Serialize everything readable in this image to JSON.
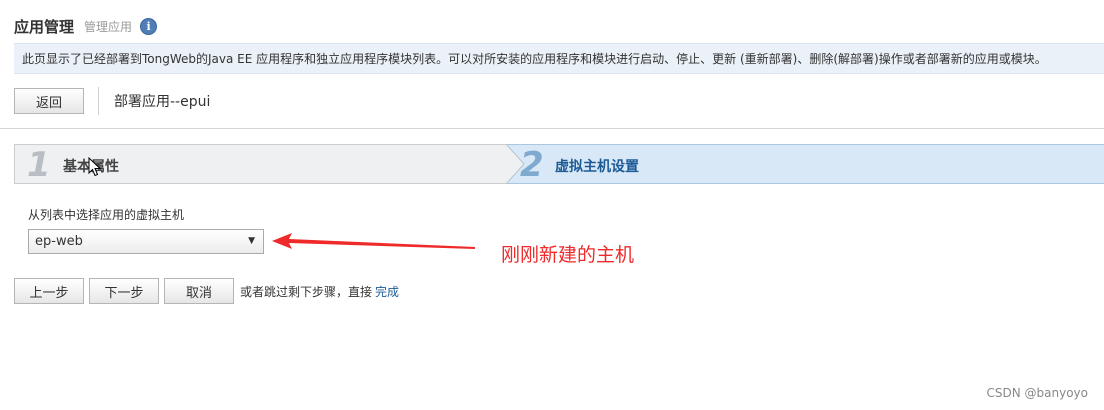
{
  "header": {
    "title": "应用管理",
    "subtitle": "管理应用",
    "info_icon": "info-icon"
  },
  "description": "此页显示了已经部署到TongWeb的Java EE 应用程序和独立应用程序模块列表。可以对所安装的应用程序和模块进行启动、停止、更新 (重新部署)、删除(解部署)操作或者部署新的应用或模块。",
  "toolbar": {
    "back_label": "返回",
    "deploy_title": "部署应用--epui"
  },
  "wizard": {
    "steps": [
      {
        "number": "1",
        "label": "基本属性",
        "active": false
      },
      {
        "number": "2",
        "label": "虚拟主机设置",
        "active": true
      }
    ]
  },
  "form": {
    "field_label": "从列表中选择应用的虚拟主机",
    "virtual_host_value": "ep-web"
  },
  "annotation": {
    "text": "刚刚新建的主机",
    "color": "#ee2a2a"
  },
  "actions": {
    "prev_label": "上一步",
    "next_label": "下一步",
    "cancel_label": "取消",
    "skip_text": "或者跳过剩下步骤，直接",
    "finish_link": "完成"
  },
  "watermark": "CSDN @banyoyo",
  "colors": {
    "accent": "#1d5b96",
    "desc_bg": "#eaf1f8",
    "active_step_bg": "#d8e8f6"
  }
}
